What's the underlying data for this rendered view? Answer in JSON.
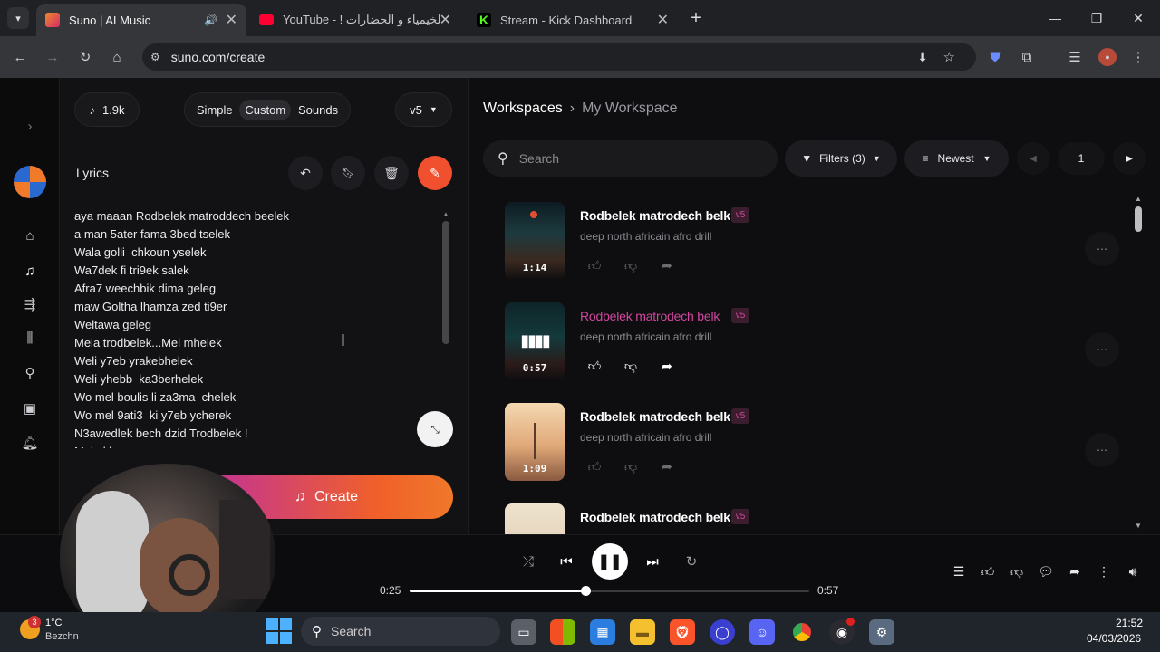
{
  "browser": {
    "tabs": [
      {
        "title": "Suno | AI Music",
        "active": true
      },
      {
        "title": "YouTube - ! الخيمياء و الحضارات",
        "active": false
      },
      {
        "title": "Stream - Kick Dashboard",
        "active": false
      }
    ],
    "new_tab": "+",
    "url": "suno.com/create"
  },
  "left": {
    "credits": "1.9k",
    "modes": [
      "Simple",
      "Custom",
      "Sounds"
    ],
    "active_mode": "Custom",
    "model": "v5",
    "lyrics_label": "Lyrics",
    "lyrics_lines": [
      "aya maaan Rodbelek matroddech beelek",
      "a man 5ater fama 3bed tselek",
      "Wala golli  chkoun yselek",
      "Wa7dek fi tri9ek salek",
      "Afra7 weechbik dima geleg",
      "maw Goltha lhamza zed ti9er",
      "Weltawa geleg",
      "Mela trodbelek...Mel mhelek",
      "Weli y7eb yrakebhelek",
      "Weli yhebb  ka3berhelek",
      "Wo mel boulis li za3ma  chelek",
      "Wo mel 9ati3  ki y7eb ycherek",
      "N3awedlek bech dzid Trodbelek !",
      "Mel el bs..."
    ],
    "create_label": "Create"
  },
  "workspace": {
    "breadcrumb_root": "Workspaces",
    "breadcrumb_current": "My Workspace",
    "search_placeholder": "Search",
    "filters_label": "Filters (3)",
    "sort_label": "Newest",
    "page": "1"
  },
  "songs": [
    {
      "title": "Rodbelek matrodech belk",
      "version": "v5",
      "desc": "deep north africain afro drill",
      "duration": "1:14",
      "playing": false
    },
    {
      "title": "Rodbelek matrodech belk",
      "version": "v5",
      "desc": "deep north africain afro drill",
      "duration": "0:57",
      "playing": true
    },
    {
      "title": "Rodbelek matrodech belk",
      "version": "v5",
      "desc": "deep north africain afro drill",
      "duration": "1:09",
      "playing": false
    },
    {
      "title": "Rodbelek matrodech belk",
      "version": "v5",
      "desc": "",
      "duration": "",
      "playing": false
    }
  ],
  "player": {
    "elapsed": "0:25",
    "total": "0:57",
    "progress": 0.44
  },
  "taskbar": {
    "weather_temp": "1°C",
    "weather_place": "Bezchn",
    "weather_badge": "3",
    "search_placeholder": "Search",
    "time": "21:52",
    "date": "04/03/2026"
  },
  "colors": {
    "accent_pink": "#d0479e",
    "create_gradient_start": "#c0309b",
    "create_gradient_end": "#f0782a",
    "magic_button": "#f0502e"
  }
}
